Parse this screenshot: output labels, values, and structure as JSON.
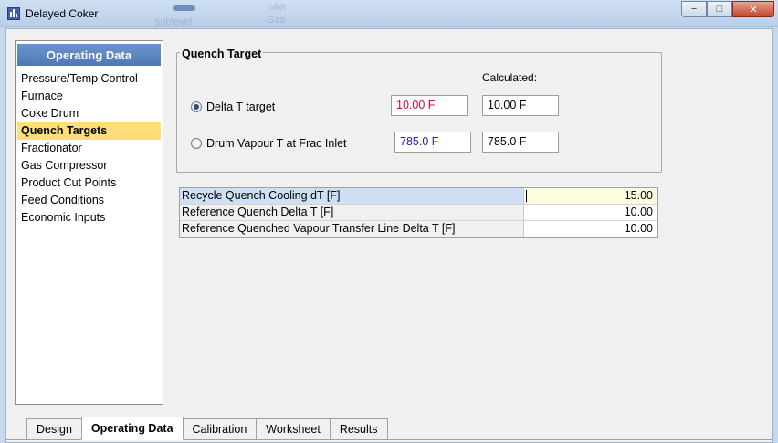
{
  "window": {
    "title": "Delayed Coker",
    "minimize": "−",
    "maximize": "□",
    "close": "✕"
  },
  "background_ghost": {
    "g1": "sublevel",
    "g2": "Inlet",
    "g3": "Gas"
  },
  "nav": {
    "header": "Operating Data",
    "items": [
      "Pressure/Temp Control",
      "Furnace",
      "Coke Drum",
      "Quench Targets",
      "Fractionator",
      "Gas Compressor",
      "Product Cut Points",
      "Feed Conditions",
      "Economic Inputs"
    ],
    "selected": "Quench Targets"
  },
  "quench_target": {
    "title": "Quench Target",
    "calculated_label": "Calculated:",
    "delta_t": {
      "label": "Delta T target",
      "input": "10.00 F",
      "calculated": "10.00 F",
      "selected": true
    },
    "drum_vapour": {
      "label": "Drum Vapour T at Frac Inlet",
      "input": "785.0 F",
      "calculated": "785.0 F",
      "selected": false
    }
  },
  "grid": {
    "rows": [
      {
        "label": "Recycle Quench Cooling dT [F]",
        "value": "15.00"
      },
      {
        "label": "Reference Quench Delta T [F]",
        "value": "10.00"
      },
      {
        "label": "Reference Quenched Vapour Transfer Line Delta T [F]",
        "value": "10.00"
      }
    ]
  },
  "tabs": [
    "Design",
    "Operating Data",
    "Calibration",
    "Worksheet",
    "Results"
  ],
  "active_tab": "Operating Data",
  "colors": {
    "accent_header": "#5a83bf",
    "selected_item": "#ffde7a",
    "red_value": "#c8102e",
    "blue_value": "#1f1fa8"
  }
}
